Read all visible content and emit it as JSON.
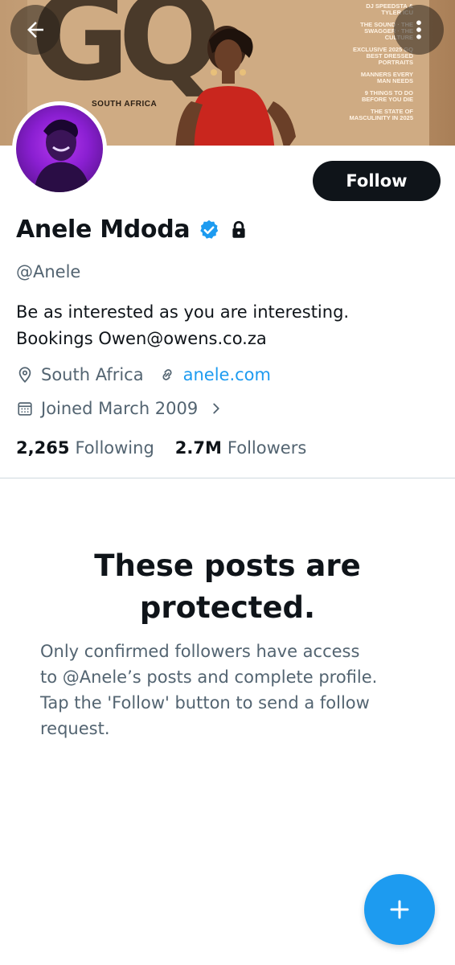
{
  "banner": {
    "logo_text": "GQ",
    "region_text": "SOUTH AFRICA",
    "cover_lines": [
      "DJ SPEEDSTA & TYLER ICU",
      "THE SOUND · THE SWAGGER · THE CULTURE",
      "EXCLUSIVE 2025 GQ BEST DRESSED PORTRAITS",
      "MANNERS EVERY MAN NEEDS",
      "9 THINGS TO DO BEFORE YOU DIE",
      "THE STATE OF MASCULINITY IN 2025"
    ]
  },
  "top_bar": {
    "back_icon": "arrow-left-icon",
    "more_icon": "more-vertical-icon"
  },
  "profile": {
    "display_name": "Anele Mdoda",
    "handle": "@Anele",
    "verified_icon": "verified-badge-icon",
    "protected_icon": "lock-icon",
    "bio_line_1": "Be as interested as you are interesting.",
    "bio_line_2": "Bookings Owen@owens.co.za",
    "location": "South Africa",
    "website": "anele.com",
    "joined": "Joined March 2009",
    "following_count": "2,265",
    "following_label": "Following",
    "followers_count": "2.7M",
    "followers_label": "Followers"
  },
  "actions": {
    "follow_label": "Follow",
    "fab_icon": "plus-icon"
  },
  "protected_notice": {
    "title_line_1": "These posts are",
    "title_line_2": "protected.",
    "desc_line_1": "Only confirmed followers have access",
    "desc_line_2": "to @Anele’s posts and complete profile.",
    "desc_line_3": "Tap the 'Follow' button to send a follow",
    "desc_line_4": "request."
  },
  "colors": {
    "accent": "#1d9bf0",
    "text_primary": "#0f1419",
    "text_secondary": "#536471",
    "follow_bg": "#0f1419",
    "avatar_purple": "#8a1fd1"
  }
}
